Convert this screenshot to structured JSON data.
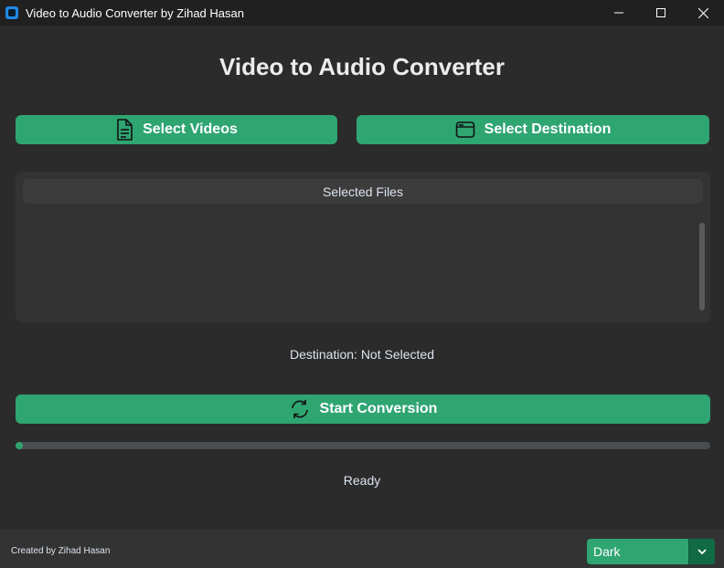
{
  "window": {
    "title": "Video to Audio Converter by Zihad Hasan",
    "controls": [
      "minimize-icon",
      "maximize-icon",
      "close-icon"
    ]
  },
  "main": {
    "heading": "Video to Audio Converter",
    "select_videos_label": "Select Videos",
    "select_destination_label": "Select Destination",
    "files_header": "Selected Files",
    "files": [],
    "destination_text": "Destination: Not Selected",
    "start_label": "Start Conversion",
    "progress": 0.01,
    "status": "Ready"
  },
  "footer": {
    "credit": "Created by Zihad Hasan",
    "theme_value": "Dark"
  },
  "colors": {
    "accent": "#2fa572",
    "accent_dark": "#106a43",
    "background": "#2b2b2b",
    "titlebar": "#202020"
  }
}
